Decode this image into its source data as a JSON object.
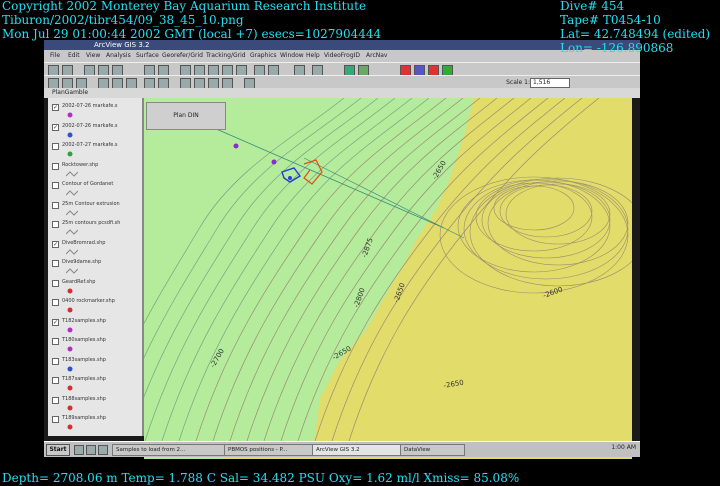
{
  "overlay": {
    "copyright": "Copyright 2002 Monterey Bay Aquarium Research Institute",
    "filepath": "Tiburon/2002/tibr454/09_38_45_10.png",
    "datetime": "Mon Jul 29 01:00:44 2002 GMT (local +7)  esecs=1027904444",
    "dive": "Dive# 454",
    "tape": "Tape# T0454-10",
    "lat": "Lat= 42.748494 (edited)",
    "lon": "Lon= -126.890868",
    "sensors": "Depth= 2708.06 m  Temp= 1.788 C  Sal= 34.482 PSU  Oxy= 1.62 ml/l  Xmiss= 85.08%"
  },
  "app": {
    "title": "ArcView GIS 3.2",
    "menu": [
      "File",
      "Edit",
      "View",
      "Analysis",
      "Surface",
      "Georefer/Grid",
      "Tracking/Grid",
      "Graphics",
      "Window",
      "Help",
      "VideoFrogID",
      "ArcNav"
    ],
    "scale_label": "Scale 1:",
    "scale_value": "1,516",
    "view_title": "PlanGamble",
    "panel_button": "Plan DIN",
    "layers": [
      {
        "label": "2002-07-26 markafe.s",
        "checked": true,
        "symbol": "magenta-dot"
      },
      {
        "label": "2002-07-26 markafe.s",
        "checked": true,
        "symbol": "blue-dot"
      },
      {
        "label": "2002-07-27 markafe.s",
        "checked": false,
        "symbol": "green-dot"
      },
      {
        "label": "Rocktower.shp",
        "checked": false,
        "symbol": "line"
      },
      {
        "label": "Contour of Gordanet",
        "checked": false,
        "symbol": "line"
      },
      {
        "label": "25m Contour extrusion",
        "checked": false,
        "symbol": "line"
      },
      {
        "label": "25m contours pcsdfi.sh",
        "checked": false,
        "symbol": "line"
      },
      {
        "label": "DiveBromrad.shp",
        "checked": true,
        "symbol": "line"
      },
      {
        "label": "Dive9dame.shp",
        "checked": false,
        "symbol": "line"
      },
      {
        "label": "GeardRef.shp",
        "checked": false,
        "symbol": "red-dot"
      },
      {
        "label": "0400 rockmarker.shp",
        "checked": false,
        "symbol": "red-dot"
      },
      {
        "label": "T182samples.shp",
        "checked": true,
        "symbol": "magenta-dot"
      },
      {
        "label": "T180samples.shp",
        "checked": false,
        "symbol": "magenta-dot"
      },
      {
        "label": "T183samples.shp",
        "checked": false,
        "symbol": "blue-dot"
      },
      {
        "label": "T187samples.shp",
        "checked": false,
        "symbol": "red-dot"
      },
      {
        "label": "T188samples.shp",
        "checked": false,
        "symbol": "red-dot"
      },
      {
        "label": "T189samples.shp",
        "checked": false,
        "symbol": "red-dot"
      }
    ],
    "contour_labels": [
      "-2650",
      "-2875",
      "-2800",
      "-2650",
      "-2700",
      "-2650",
      "-2650",
      "-2600"
    ],
    "taskbar": {
      "start": "Start",
      "tasks": [
        "Samples to load from 2...",
        "PBMOS positions - P...",
        "ArcView GIS 3.2",
        "DataView"
      ],
      "clock": "1:00 AM"
    }
  },
  "colors": {
    "overlay_text": "#22e0f0",
    "map_green": "#b4ec9c",
    "map_yellow": "#e2dc6a"
  }
}
